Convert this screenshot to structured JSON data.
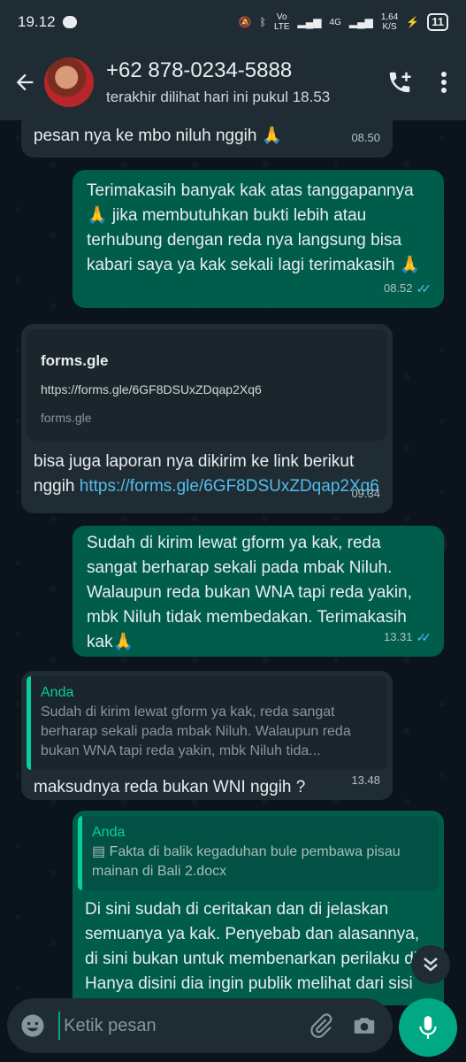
{
  "status": {
    "time": "19.12",
    "net_speed_top": "1,64",
    "net_speed_bottom": "K/S",
    "battery": "11",
    "volte": "Vo",
    "lte": "LTE",
    "net4g": "4G"
  },
  "header": {
    "contact": "+62 878-0234-5888",
    "last_seen": "terakhir dilihat hari ini pukul 18.53"
  },
  "messages": [
    {
      "text": "pesan nya ke mbo niluh nggih 🙏",
      "time": "08.50"
    },
    {
      "text": "Terimakasih banyak kak atas tanggapannya 🙏 jika membutuhkan bukti lebih atau terhubung dengan reda nya langsung bisa kabari saya ya kak sekali lagi terimakasih 🙏",
      "time": "08.52"
    },
    {
      "preview_domain": "forms.gle",
      "preview_url": "https://forms.gle/6GF8DSUxZDqap2Xq6",
      "preview_site": "forms.gle",
      "text": "bisa juga laporan nya dikirim ke link berikut nggih ",
      "link": "https://forms.gle/6GF8DSUxZDqap2Xq6",
      "time": "09.34"
    },
    {
      "text": "Sudah di kirim lewat gform ya kak, reda sangat berharap sekali pada mbak Niluh. Walaupun reda bukan WNA tapi reda yakin, mbk Niluh tidak membedakan. Terimakasih kak🙏",
      "time": "13.31"
    },
    {
      "quote_author": "Anda",
      "quote_text": "Sudah di kirim lewat gform ya kak, reda sangat berharap sekali pada mbak Niluh. Walaupun reda bukan WNA tapi reda yakin, mbk Niluh tida...",
      "text": "maksudnya reda bukan WNI nggih ?",
      "time": "13.48"
    },
    {
      "quote_author": "Anda",
      "quote_text": "Fakta di balik kegaduhan bule pembawa pisau mainan di Bali 2.docx",
      "text": "Di sini sudah di ceritakan dan di jelaskan semuanya ya kak. Penyebab dan alasannya, di sini bukan untuk membenarkan perilaku dia. Hanya disini dia ingin publik melihat dari sisi dia."
    }
  ],
  "input": {
    "placeholder": "Ketik pesan"
  },
  "icons": [
    "back-arrow-icon",
    "add-call-icon",
    "more-vert-icon",
    "forward-icon",
    "scroll-down-icon",
    "emoji-icon",
    "attach-icon",
    "camera-icon",
    "mic-icon",
    "document-icon"
  ],
  "colors": {
    "header": "#1f2c34",
    "outgoing": "#005c4b",
    "incoming": "#1f2c34",
    "accent": "#00a884",
    "link": "#53bdeb"
  }
}
